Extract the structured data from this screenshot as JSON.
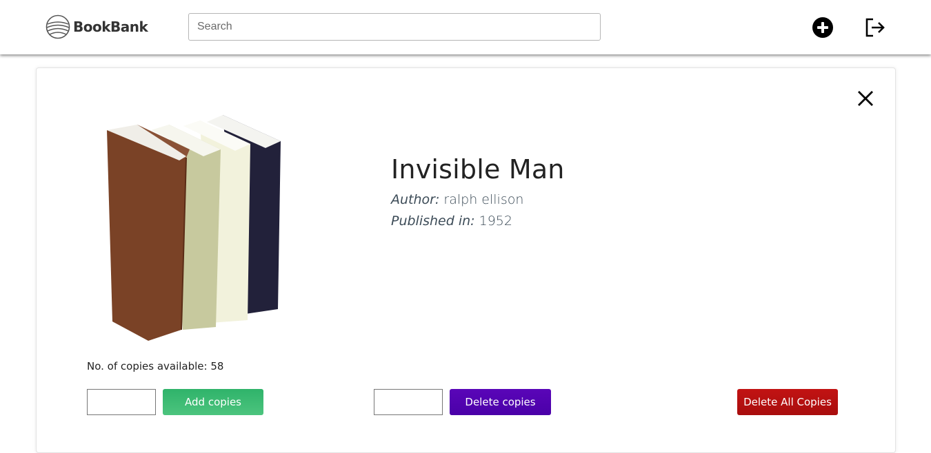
{
  "header": {
    "logo_text": "BookBank",
    "search_placeholder": "Search",
    "icons": {
      "add": "plus-circle-icon",
      "logout": "logout-icon"
    }
  },
  "book": {
    "title": "Invisible Man",
    "author_label": "Author:",
    "author": "ralph ellison",
    "published_label": "Published in:",
    "published": "1952",
    "copies_label": "No. of copies available:",
    "copies": "58"
  },
  "actions": {
    "add_label": "Add copies",
    "delete_label": "Delete copies",
    "delete_all_label": "Delete All Copies",
    "add_qty": "",
    "delete_qty": ""
  },
  "colors": {
    "add_button": "#3dba73",
    "delete_button": "#5200b0",
    "delete_all_button": "#b51010"
  }
}
